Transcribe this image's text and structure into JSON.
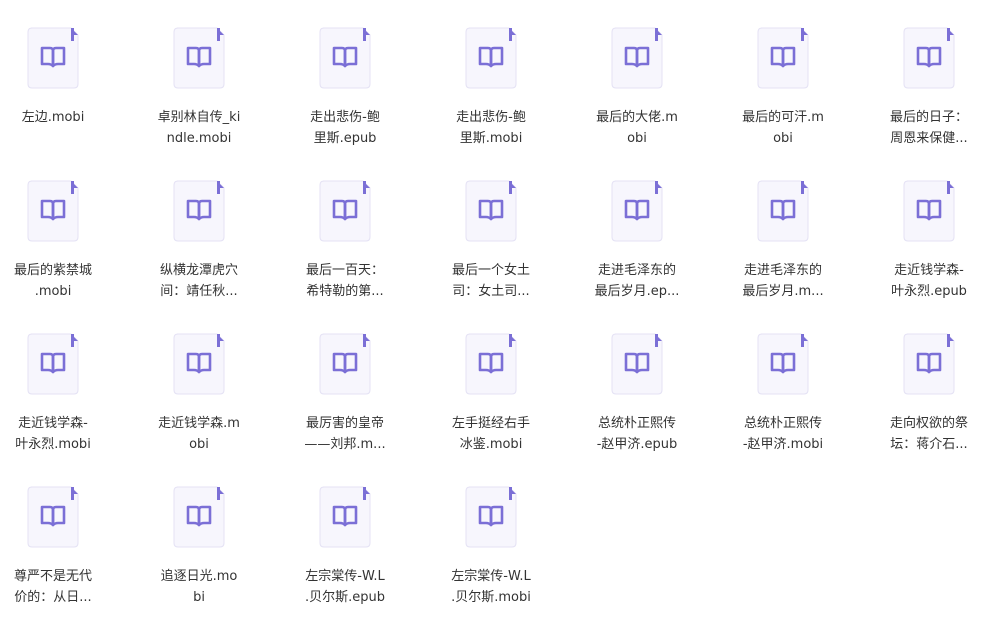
{
  "accent_color": "#7b6fd6",
  "icon": "ebook-file-icon",
  "files": [
    {
      "line1": "左边.mobi",
      "line2": ""
    },
    {
      "line1": "卓别林自传_ki",
      "line2": "ndle.mobi"
    },
    {
      "line1": "走出悲伤-鲍",
      "line2": "里斯.epub"
    },
    {
      "line1": "走出悲伤-鲍",
      "line2": "里斯.mobi"
    },
    {
      "line1": "最后的大佬.m",
      "line2": "obi"
    },
    {
      "line1": "最后的可汗.m",
      "line2": "obi"
    },
    {
      "line1": "最后的日子：",
      "line2": "周恩来保健..."
    },
    {
      "line1": "最后的紫禁城",
      "line2": ".mobi"
    },
    {
      "line1": "纵横龙潭虎穴",
      "line2": "间：靖任秋..."
    },
    {
      "line1": "最后一百天：",
      "line2": "希特勒的第..."
    },
    {
      "line1": "最后一个女土",
      "line2": "司：女土司..."
    },
    {
      "line1": "走进毛泽东的",
      "line2": "最后岁月.ep..."
    },
    {
      "line1": "走进毛泽东的",
      "line2": "最后岁月.m..."
    },
    {
      "line1": "走近钱学森-",
      "line2": "叶永烈.epub"
    },
    {
      "line1": "走近钱学森-",
      "line2": "叶永烈.mobi"
    },
    {
      "line1": "走近钱学森.m",
      "line2": "obi"
    },
    {
      "line1": "最厉害的皇帝",
      "line2": "——刘邦.m..."
    },
    {
      "line1": "左手挺经右手",
      "line2": "冰鉴.mobi"
    },
    {
      "line1": "总统朴正熙传",
      "line2": "-赵甲济.epub"
    },
    {
      "line1": "总统朴正熙传",
      "line2": "-赵甲济.mobi"
    },
    {
      "line1": "走向权欲的祭",
      "line2": "坛：蒋介石..."
    },
    {
      "line1": "尊严不是无代",
      "line2": "价的：从日..."
    },
    {
      "line1": "追逐日光.mo",
      "line2": "bi"
    },
    {
      "line1": "左宗棠传-W.L",
      "line2": ".贝尔斯.epub"
    },
    {
      "line1": "左宗棠传-W.L",
      "line2": ".贝尔斯.mobi"
    }
  ]
}
